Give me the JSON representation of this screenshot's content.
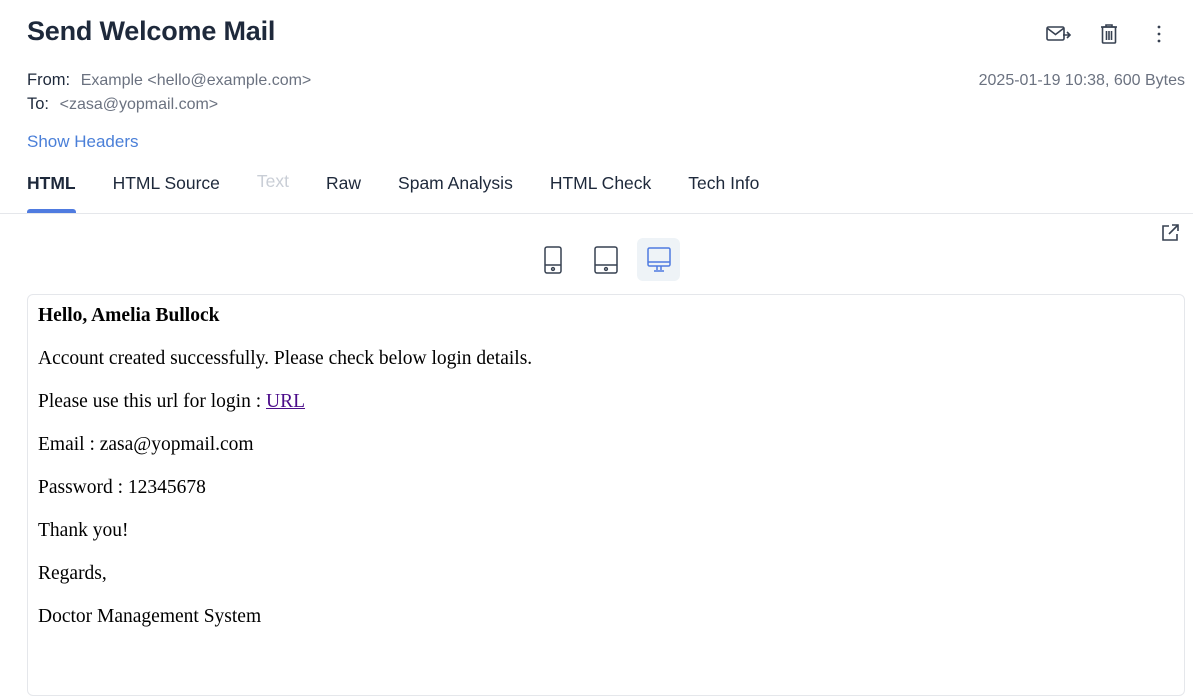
{
  "header": {
    "title": "Send Welcome Mail",
    "actions": [
      "forward-mail-icon",
      "trash-icon",
      "more-vertical-icon"
    ]
  },
  "meta": {
    "from_label": "From:",
    "from_value": "Example <hello@example.com>",
    "to_label": "To:",
    "to_value": "<zasa@yopmail.com>",
    "date_size": "2025-01-19 10:38, 600 Bytes"
  },
  "show_headers": "Show Headers",
  "tabs": [
    {
      "label": "HTML",
      "state": "active"
    },
    {
      "label": "HTML Source",
      "state": "normal"
    },
    {
      "label": "Text",
      "state": "disabled"
    },
    {
      "label": "Raw",
      "state": "normal"
    },
    {
      "label": "Spam Analysis",
      "state": "normal"
    },
    {
      "label": "HTML Check",
      "state": "normal"
    },
    {
      "label": "Tech Info",
      "state": "normal"
    }
  ],
  "device_toggle": {
    "options": [
      "phone-icon",
      "tablet-icon",
      "desktop-icon"
    ],
    "selected": "desktop-icon"
  },
  "colors": {
    "accent": "#4f7be0",
    "link": "#4a7fd8",
    "mail_link": "#4b0c8a"
  },
  "mail": {
    "greeting": "Hello, Amelia Bullock",
    "line1": "Account created successfully. Please check below login details.",
    "url_prefix": "Please use this url for login : ",
    "url_label": "URL",
    "email_line": "Email : zasa@yopmail.com",
    "password_line": "Password : 12345678",
    "thanks": "Thank you!",
    "regards": "Regards,",
    "signature": "Doctor Management System"
  }
}
